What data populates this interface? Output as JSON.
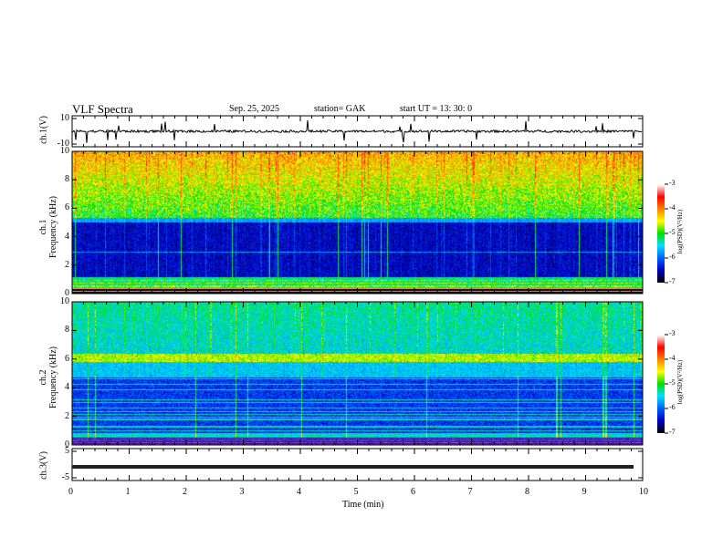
{
  "header": {
    "title": "VLF  Spectra",
    "date": "Sep. 25,  2025",
    "station": "station= GAK",
    "start": "start  UT  =    13: 30: 0"
  },
  "chart_data": [
    {
      "type": "line",
      "name": "ch1-waveform",
      "ylabel": "ch.1(V)",
      "ylim": [
        -10,
        10
      ],
      "yticks": [
        "10",
        "-10"
      ],
      "baseline": 0
    },
    {
      "type": "heatmap",
      "name": "ch1-spectrogram",
      "ylabel": "ch.1\nFrequency  (kHz)",
      "ylabel_top": "ch.1",
      "ylabel_bottom": "Frequency  (kHz)",
      "ylim": [
        0,
        10
      ],
      "yticks": [
        "0",
        "2",
        "4",
        "6",
        "8",
        "10"
      ],
      "colorbar": {
        "label": "log(PSD)(V²/Hz)",
        "range": [
          -7,
          -3
        ],
        "ticks": [
          "-3",
          "-4",
          "-5",
          "-6",
          "-7"
        ]
      }
    },
    {
      "type": "heatmap",
      "name": "ch2-spectrogram",
      "ylabel_top": "ch.2",
      "ylabel_bottom": "Frequency  (kHz)",
      "ylim": [
        0,
        10
      ],
      "yticks": [
        "0",
        "2",
        "4",
        "6",
        "8",
        "10"
      ],
      "colorbar": {
        "label": "log(PSD)(V²/Hz)",
        "range": [
          -7,
          -3
        ],
        "ticks": [
          "-3",
          "-4",
          "-5",
          "-6",
          "-7"
        ]
      }
    },
    {
      "type": "line",
      "name": "ch3-waveform",
      "ylabel": "ch.3(V)",
      "ylim": [
        -5,
        5
      ],
      "yticks": [
        "5",
        "-5"
      ],
      "baseline": 0
    }
  ],
  "xaxis": {
    "label": "Time  (min)",
    "xlim": [
      0,
      10
    ],
    "ticks": [
      "0",
      "1",
      "2",
      "3",
      "4",
      "5",
      "6",
      "7",
      "8",
      "9",
      "10"
    ]
  },
  "colors": {
    "colormap": [
      "#000000",
      "#0000c8",
      "#0060ff",
      "#00e0ff",
      "#00e000",
      "#ffff00",
      "#ff8000",
      "#ff0000",
      "#ffffff"
    ]
  }
}
